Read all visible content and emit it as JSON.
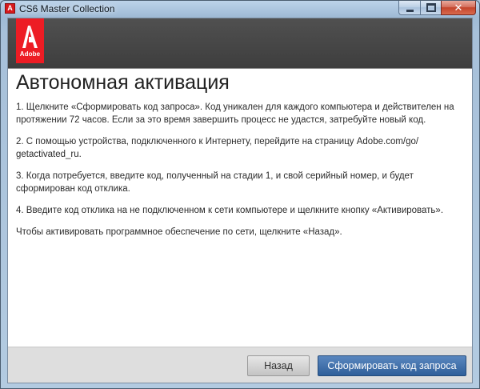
{
  "window": {
    "title": "CS6 Master Collection",
    "app_icon": "adobe-app-icon",
    "app_icon_glyph": "A",
    "controls": [
      "minimize",
      "maximize",
      "close"
    ],
    "close_glyph": "✕"
  },
  "header": {
    "logo_text": "Adobe",
    "logo_color": "#ed1c24"
  },
  "main": {
    "title": "Автономная активация",
    "steps": [
      "1. Щелкните «Сформировать код запроса». Код уникален для каждого компьютера и действителен на протяжении 72 часов. Если за это время завершить процесс не удастся, затребуйте новый код.",
      "2. С помощью устройства, подключенного к Интернету, перейдите на страницу Adobe.com/go/ getactivated_ru.",
      "3. Когда потребуется, введите код, полученный на стадии 1, и свой серийный номер, и будет сформирован код отклика.",
      "4. Введите код отклика на не подключенном к сети компьютере и щелкните кнопку «Активировать»."
    ],
    "note": "Чтобы активировать программное обеспечение по сети, щелкните «Назад»."
  },
  "footer": {
    "back_label": "Назад",
    "generate_label": "Сформировать код запроса",
    "primary_color": "#2f5f9a"
  }
}
